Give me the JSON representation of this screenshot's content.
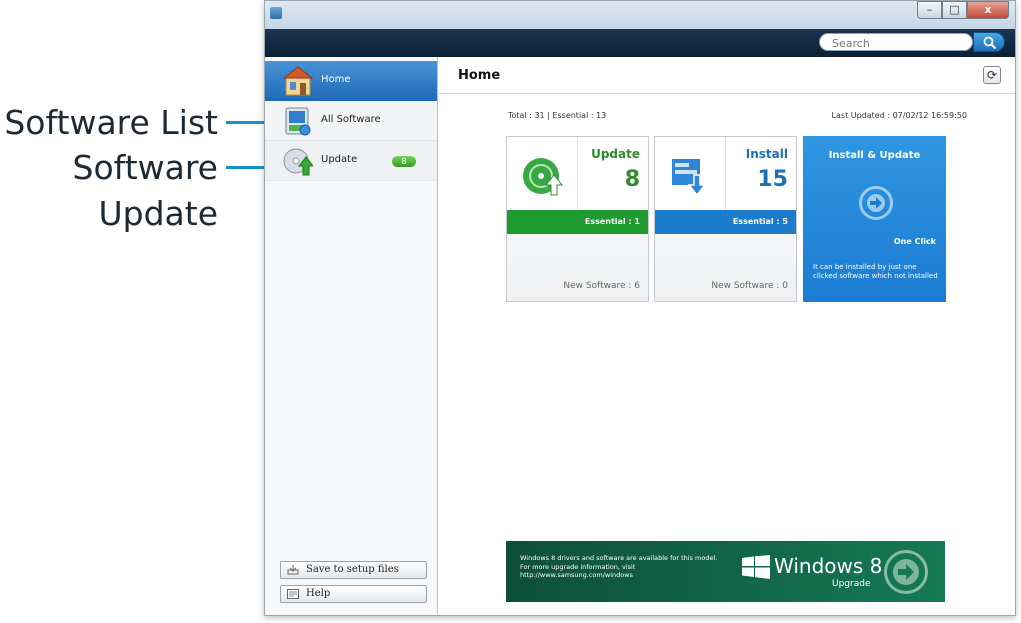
{
  "callouts": {
    "software_list": "Software List",
    "software_update_line1": "Software",
    "software_update_line2": "Update"
  },
  "window": {
    "buttons": {
      "minimize": "–",
      "maximize": "□",
      "close": "x"
    }
  },
  "search": {
    "placeholder": "Search"
  },
  "sidebar": {
    "items": [
      {
        "label": "Home",
        "icon": "home-icon",
        "selected": true
      },
      {
        "label": "All Software",
        "icon": "all-software-icon"
      },
      {
        "label": "Update",
        "icon": "update-icon",
        "badge": "8"
      }
    ],
    "save_label": "Save to setup files",
    "help_label": "Help"
  },
  "main": {
    "title": "Home",
    "refresh_icon": "refresh-icon",
    "stats": "Total : 31 | Essential : 13",
    "last_updated": "Last Updated : 07/02/12 16:59:50",
    "cards": {
      "update": {
        "title": "Update",
        "count": "8",
        "essential": "Essential : 1",
        "new_software": "New Software : 6"
      },
      "install": {
        "title": "Install",
        "count": "15",
        "essential": "Essential : 5",
        "new_software": "New Software : 0"
      },
      "install_update": {
        "title": "Install & Update",
        "one_click": "One Click",
        "description": "It can be installed by just one clicked software which not installed"
      }
    },
    "banner": {
      "text": "Windows 8 drivers and software are available for this model. For more upgrade information, visit http://www.samsung.com/windows",
      "title": "Windows 8",
      "subtitle": "Upgrade"
    }
  },
  "colors": {
    "accent_blue": "#1b7ccc",
    "accent_green": "#1f9a2e",
    "callout": "#1592c8",
    "banner": "#157a55"
  }
}
